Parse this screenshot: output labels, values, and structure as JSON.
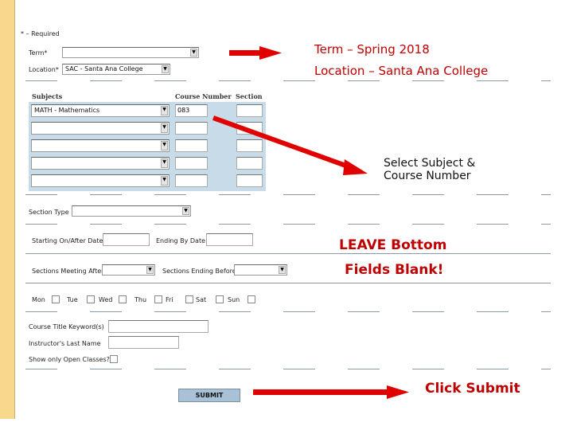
{
  "form": {
    "required_note": "* – Required",
    "term_label": "Term*",
    "term_value": "",
    "location_label": "Location*",
    "location_value": "SAC - Santa Ana College",
    "subjects_header": "Subjects",
    "course_number_header": "Course Number",
    "section_header": "Section",
    "subject_rows": [
      {
        "subject": "MATH - Mathematics",
        "course": "083",
        "section": ""
      },
      {
        "subject": "",
        "course": "",
        "section": ""
      },
      {
        "subject": "",
        "course": "",
        "section": ""
      },
      {
        "subject": "",
        "course": "",
        "section": ""
      },
      {
        "subject": "",
        "course": "",
        "section": ""
      }
    ],
    "section_type_label": "Section Type",
    "start_date_label": "Starting On/After Date",
    "end_date_label": "Ending By Date",
    "meeting_after_label": "Sections Meeting After",
    "ending_before_label": "Sections Ending Before",
    "days": [
      "Mon",
      "Tue",
      "Wed",
      "Thu",
      "Fri",
      "Sat",
      "Sun"
    ],
    "keyword_label": "Course Title Keyword(s)",
    "instructor_label": "Instructor's Last Name",
    "open_classes_label": "Show only Open Classes?",
    "submit_label": "SUBMIT"
  },
  "annotations": {
    "term": "Term – Spring 2018",
    "location": "Location – Santa Ana College",
    "select_subject_1": "Select Subject &",
    "select_subject_2": "Course Number",
    "leave_blank_1": "LEAVE Bottom",
    "leave_blank_2": "Fields Blank!",
    "click_submit": "Click Submit",
    "color": "#c00000"
  }
}
